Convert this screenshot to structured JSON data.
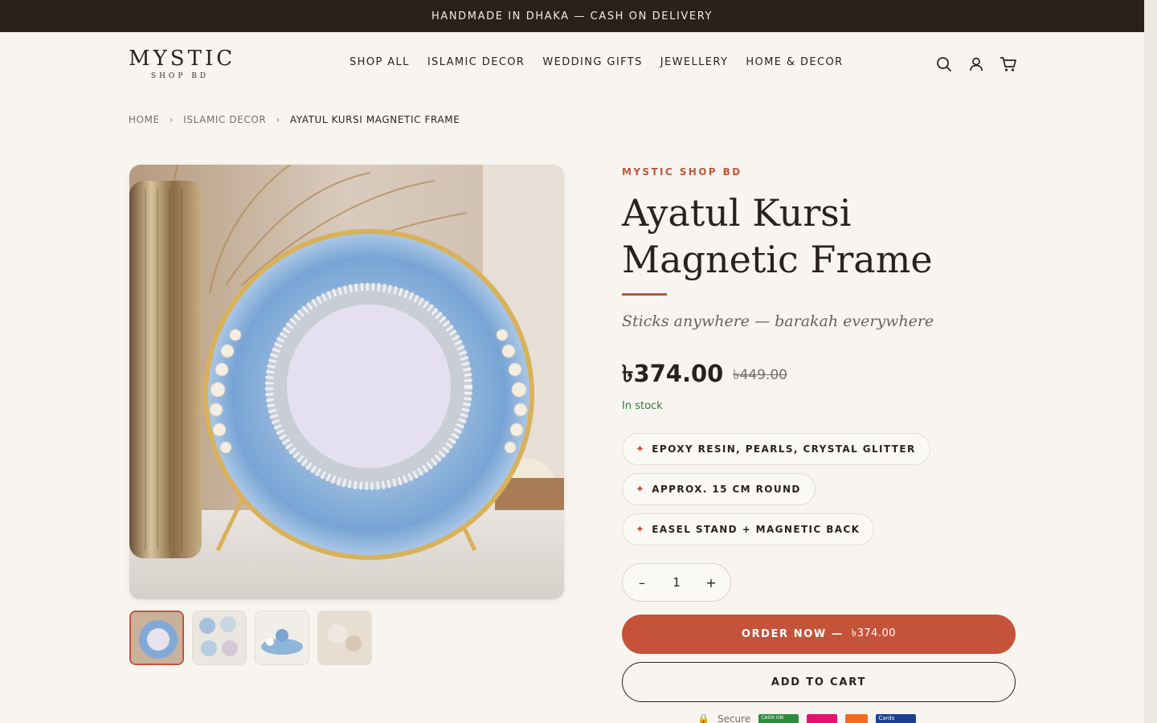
{
  "announcement": "HANDMADE IN DHAKA — CASH ON DELIVERY",
  "logo": {
    "main": "MYSTIC",
    "sub": "SHOP BD"
  },
  "nav": [
    "SHOP ALL",
    "ISLAMIC DECOR",
    "WEDDING GIFTS",
    "JEWELLERY",
    "HOME & DECOR"
  ],
  "icons": [
    "search-icon",
    "account-icon",
    "cart-icon"
  ],
  "breadcrumb": {
    "home": "HOME",
    "category": "ISLAMIC DECOR",
    "current": "AYATUL KURSI MAGNETIC FRAME"
  },
  "product": {
    "brand": "MYSTIC SHOP BD",
    "title": "Ayatul Kursi Magnetic Frame",
    "tagline": "Sticks anywhere — barakah everywhere",
    "price": "৳374.00",
    "compare_price": "৳449.00",
    "stock": "In stock",
    "features": [
      "EPOXY RESIN, PEARLS, CRYSTAL GLITTER",
      "APPROX. 15 CM ROUND",
      "EASEL STAND + MAGNETIC BACK"
    ],
    "quantity": "1",
    "order_label": "ORDER NOW —",
    "order_amount": "৳374.00",
    "add_to_cart": "ADD TO CART"
  },
  "payments": {
    "secure": "Secure",
    "cod": "CASH ON",
    "cards": "Cards"
  },
  "colors": {
    "accent": "#c4533a",
    "announcement_bg": "#2b211b",
    "page_bg": "#f8f5f0",
    "in_stock": "#2f7a3a"
  }
}
